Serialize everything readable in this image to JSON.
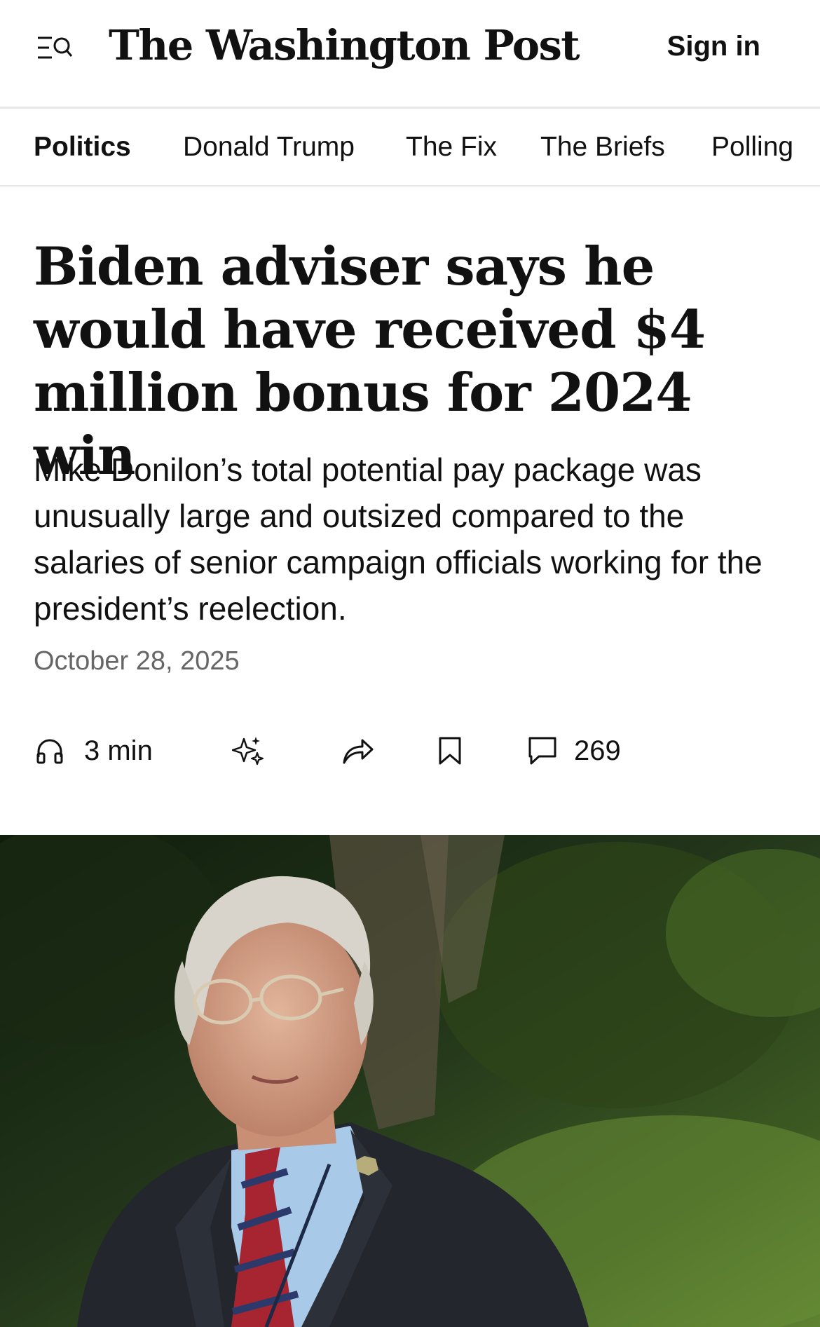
{
  "header": {
    "logo_text": "The Washington Post",
    "signin_label": "Sign in",
    "menu_icon": "menu-search-icon"
  },
  "section_nav": {
    "items": [
      {
        "label": "Politics",
        "active": true
      },
      {
        "label": "Donald Trump",
        "active": false
      },
      {
        "label": "The Fix",
        "active": false
      },
      {
        "label": "The Briefs",
        "active": false
      },
      {
        "label": "Polling",
        "active": false
      }
    ]
  },
  "article": {
    "headline": "Biden adviser says he would have received $4 million bonus for 2024 win",
    "dek": "Mike Donilon’s total potential pay package was unusually large and outsized compared to the salaries of senior campaign officials working for the president’s reelection.",
    "date": "October 28, 2025"
  },
  "actions": {
    "listen_label": "3 min",
    "listen_icon": "headphones-icon",
    "ai_icon": "sparkles-icon",
    "share_icon": "share-arrow-icon",
    "bookmark_icon": "bookmark-icon",
    "comment_icon": "comment-icon",
    "comment_count": "269"
  },
  "colors": {
    "text": "#111111",
    "muted": "#666666",
    "divider": "#e6e6e6"
  }
}
